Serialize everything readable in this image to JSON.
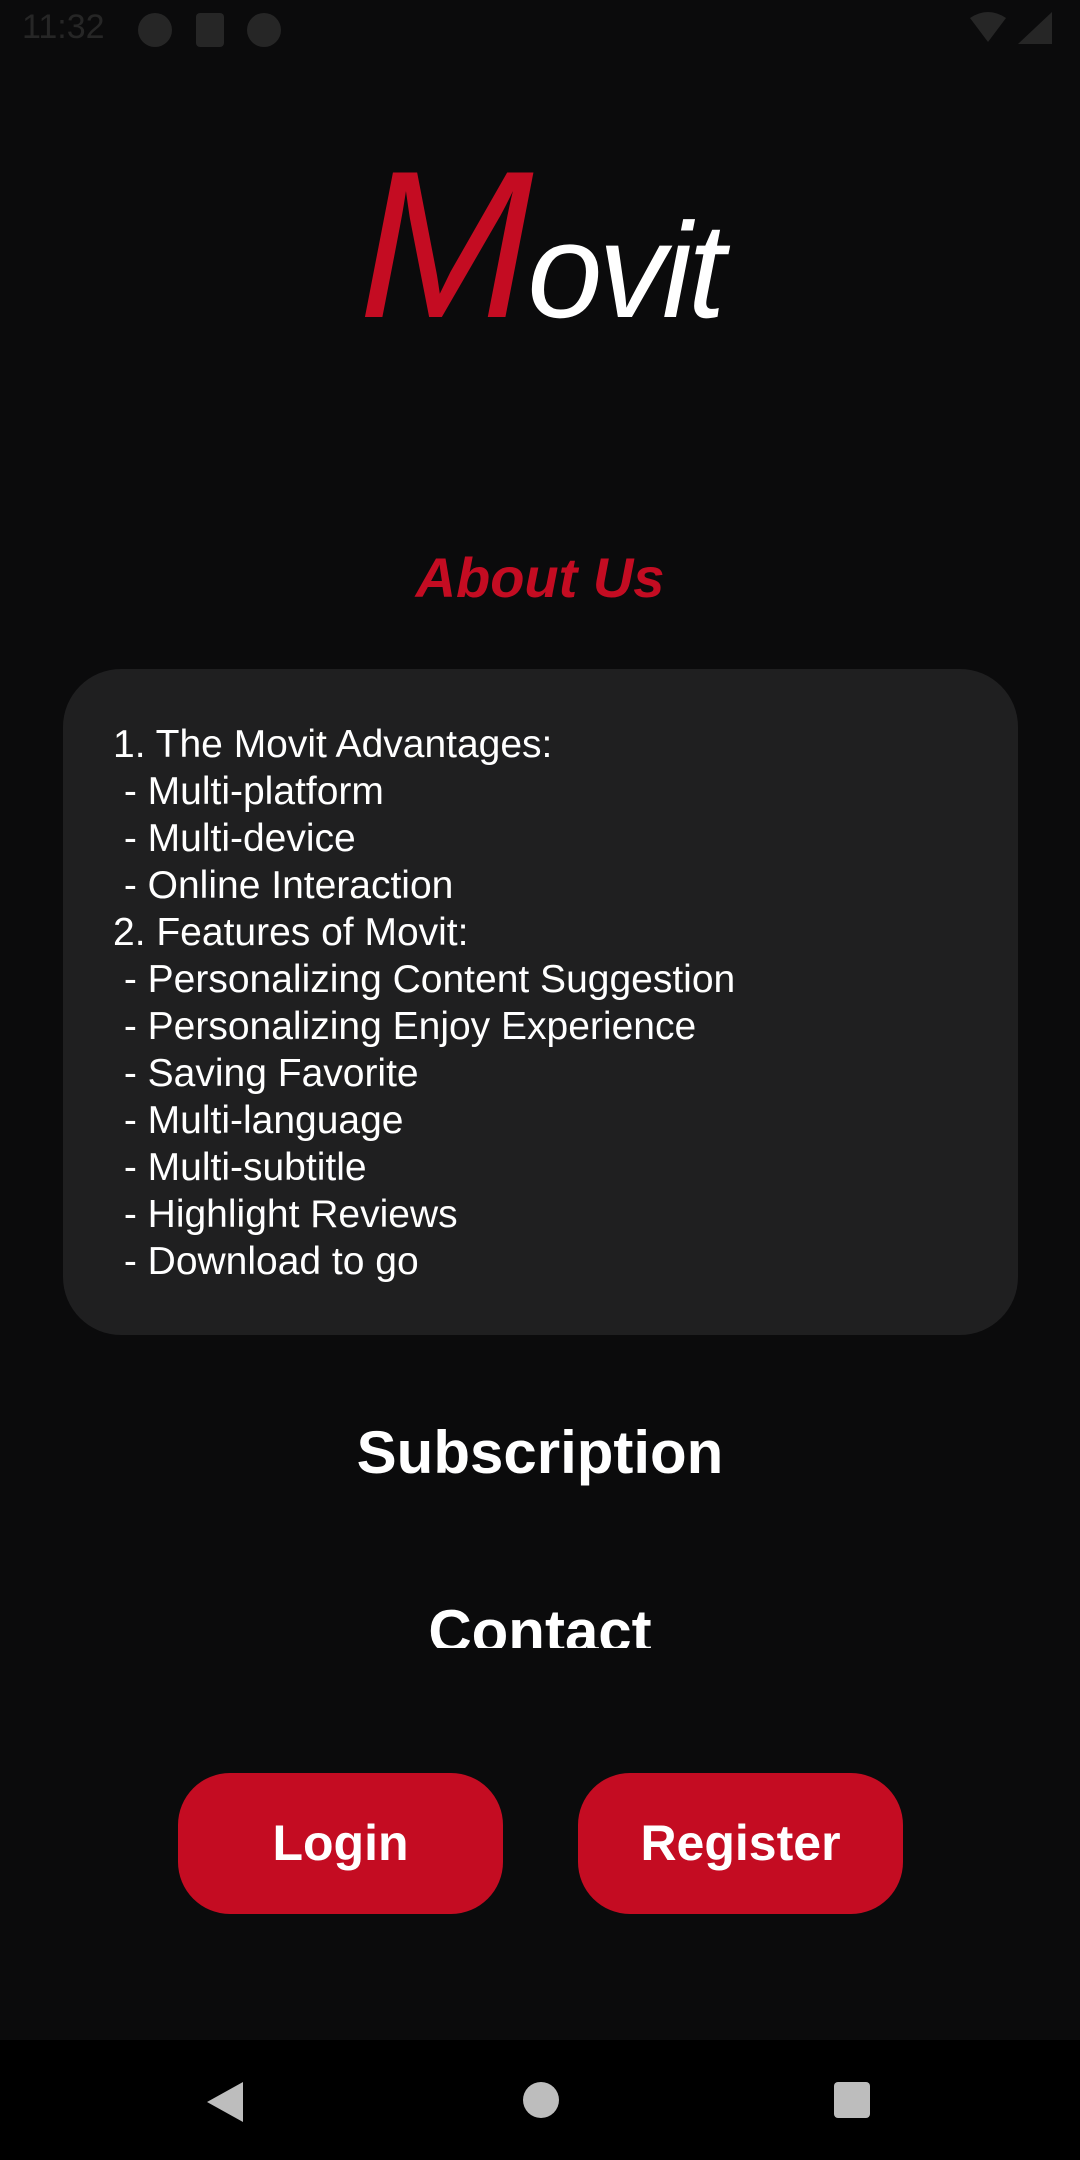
{
  "status_bar": {
    "time": "11:32",
    "icons": [
      "notification-a-icon",
      "sd-card-icon",
      "notification-p-icon",
      "wifi-icon",
      "signal-icon"
    ]
  },
  "logo": {
    "first_letter": "M",
    "rest": "ovit",
    "accent_color": "#c40c22"
  },
  "about": {
    "title": "About Us",
    "lines": [
      "1. The Movit Advantages:",
      " - Multi-platform",
      " - Multi-device",
      " - Online Interaction",
      "2. Features of Movit:",
      " - Personalizing Content Suggestion",
      " - Personalizing Enjoy Experience",
      " - Saving Favorite",
      " - Multi-language",
      " - Multi-subtitle",
      " - Highlight Reviews",
      " - Download to go"
    ]
  },
  "menu": {
    "subscription": "Subscription",
    "contact": "Contact"
  },
  "buttons": {
    "login": "Login",
    "register": "Register"
  },
  "colors": {
    "background": "#0b0b0c",
    "card": "#1f1f20",
    "accent": "#c40c22"
  },
  "nav_bar": {
    "icons": [
      "back-icon",
      "home-icon",
      "recents-icon"
    ]
  }
}
